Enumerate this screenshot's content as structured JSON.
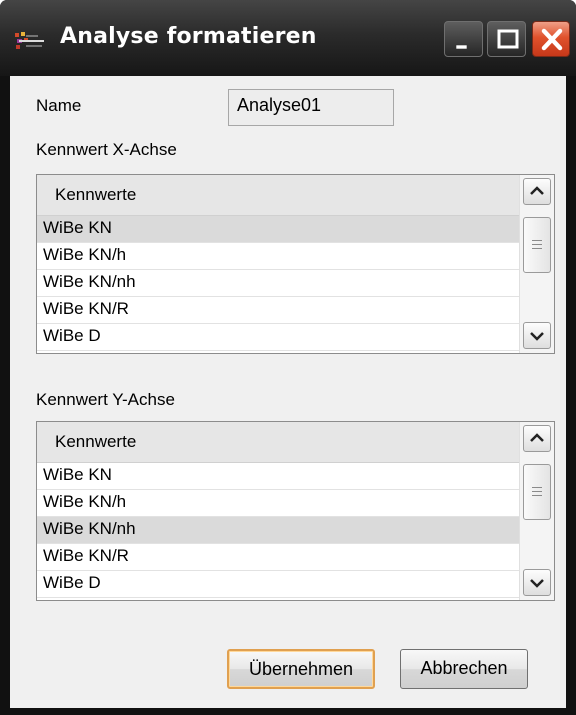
{
  "window": {
    "title": "Analyse formatieren",
    "icon": "app-icon"
  },
  "form": {
    "name_label": "Name",
    "name_value": "Analyse01"
  },
  "x_axis": {
    "label": "Kennwert X-Achse",
    "column_header": "Kennwerte",
    "items": [
      {
        "text": "WiBe KN",
        "selected": true
      },
      {
        "text": "WiBe KN/h",
        "selected": false
      },
      {
        "text": "WiBe KN/nh",
        "selected": false
      },
      {
        "text": "WiBe KN/R",
        "selected": false
      },
      {
        "text": "WiBe D",
        "selected": false
      }
    ]
  },
  "y_axis": {
    "label": "Kennwert Y-Achse",
    "column_header": "Kennwerte",
    "items": [
      {
        "text": "WiBe KN",
        "selected": false
      },
      {
        "text": "WiBe KN/h",
        "selected": false
      },
      {
        "text": "WiBe KN/nh",
        "selected": true
      },
      {
        "text": "WiBe KN/R",
        "selected": false
      },
      {
        "text": "WiBe D",
        "selected": false
      }
    ]
  },
  "buttons": {
    "apply": "Übernehmen",
    "cancel": "Abbrechen"
  },
  "colors": {
    "selection": "#dadada",
    "close_button": "#d9481f",
    "titlebar": "#2b2b2b",
    "default_button_border": "#e0a050"
  }
}
